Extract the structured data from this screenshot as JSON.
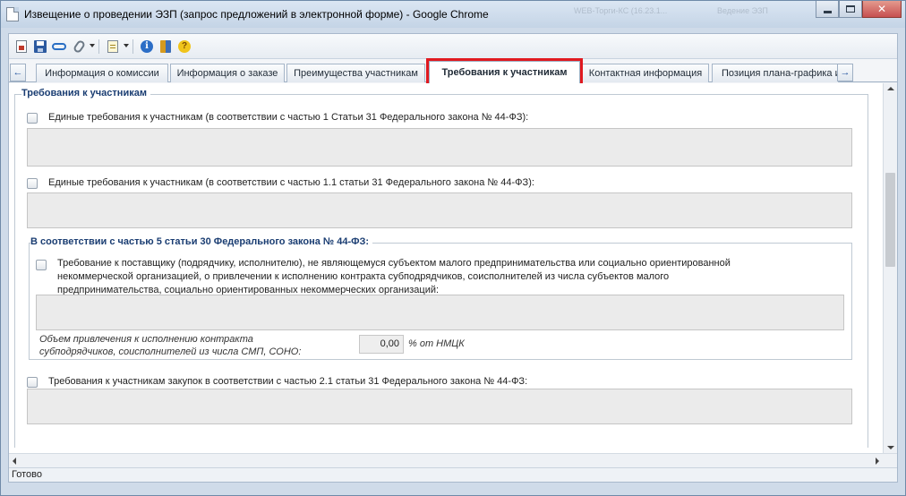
{
  "window": {
    "title": "Извещение о проведении ЭЗП (запрос предложений в электронной форме) - Google Chrome",
    "ghost_tab_1": "WEB-Торги-КС (16.23.1...",
    "ghost_tab_2": "Ведение ЭЗП"
  },
  "toolbar": {
    "icons": [
      "document-icon",
      "save-icon",
      "link-icon",
      "attach-icon",
      "paper-icon",
      "info-icon",
      "book-icon",
      "help-icon"
    ],
    "info_glyph": "i",
    "help_glyph": "?"
  },
  "tabs": [
    {
      "label": "Информация о комиссии"
    },
    {
      "label": "Информация о заказе"
    },
    {
      "label": "Преимущества участникам"
    },
    {
      "label": "Требования к участникам",
      "active": true
    },
    {
      "label": "Контактная информация"
    },
    {
      "label": "Позиция плана-графика и..."
    }
  ],
  "tab_scroll": {
    "left": "←",
    "right": "→"
  },
  "content": {
    "group_title": "Требования к участникам",
    "req1_label": "Единые требования к участникам (в соответствии с частью 1 Статьи 31 Федерального закона № 44-ФЗ):",
    "req2_label": "Единые требования к участникам (в соответствии с частью 1.1 статьи 31 Федерального закона № 44-ФЗ):",
    "sub_group_title": "В соответствии с частью 5 статьи 30 Федерального закона № 44-ФЗ:",
    "req3_line1": "Требование к поставщику (подрядчику, исполнителю), не являющемуся субъектом малого предпринимательства или социально ориентированной",
    "req3_line2": "некоммерческой организацией, о привлечении к исполнению контракта субподрядчиков, соисполнителей из числа субъектов малого",
    "req3_line3": "предпринимательства, социально ориентированных некоммерческих организаций:",
    "volume_label_line1": "Объем привлечения к исполнению контракта",
    "volume_label_line2": "субподрядчиков, соисполнителей из числа СМП, СОНО:",
    "volume_value": "0,00",
    "volume_unit": "% от НМЦК",
    "req4_label": "Требования к участникам закупок в соответствии с частью 2.1 статьи 31 Федерального закона № 44-ФЗ:"
  },
  "status": {
    "text": "Готово"
  },
  "colors": {
    "accent": "#1a3d72",
    "highlight": "#e0191f"
  }
}
